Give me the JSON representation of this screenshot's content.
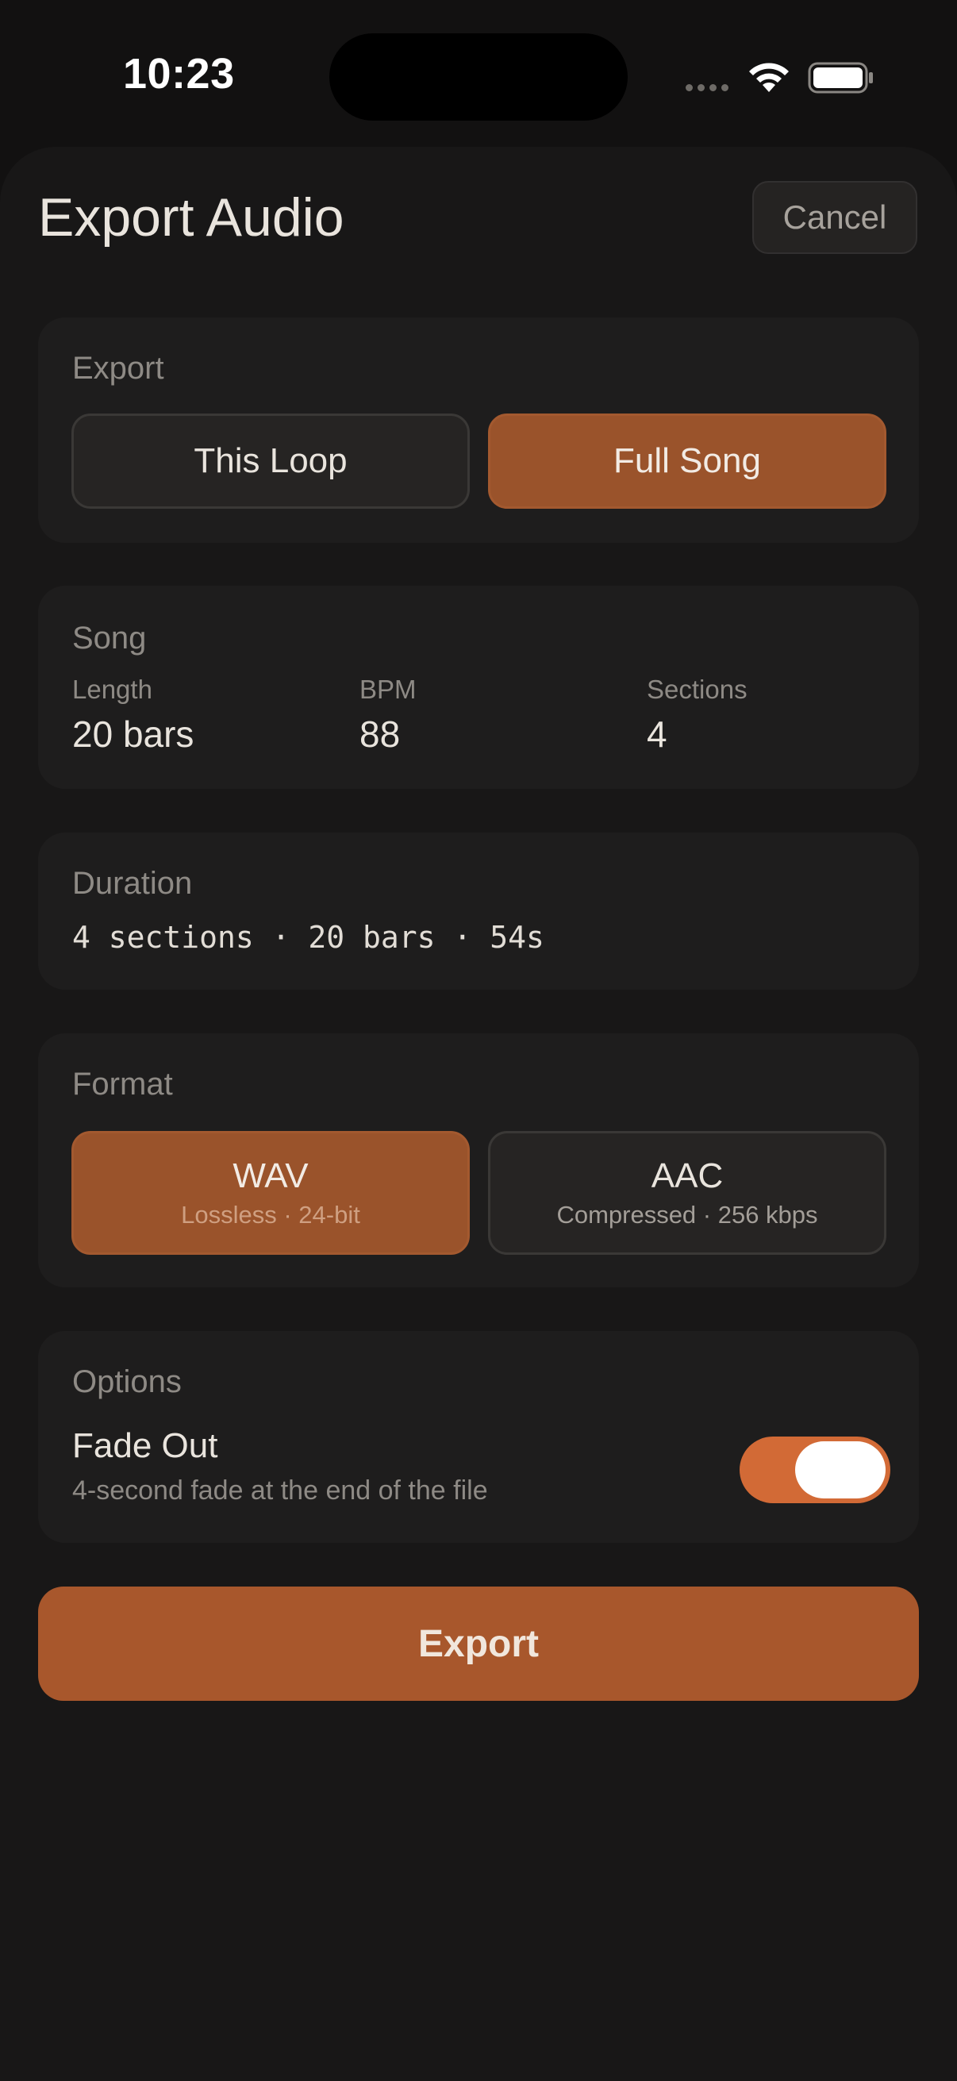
{
  "status_bar": {
    "time": "10:23"
  },
  "header": {
    "title": "Export Audio",
    "cancel_label": "Cancel"
  },
  "export_scope": {
    "heading": "Export",
    "options": [
      {
        "label": "This Loop",
        "selected": false
      },
      {
        "label": "Full Song",
        "selected": true
      }
    ]
  },
  "song": {
    "heading": "Song",
    "stats": [
      {
        "label": "Length",
        "value": "20 bars"
      },
      {
        "label": "BPM",
        "value": "88"
      },
      {
        "label": "Sections",
        "value": "4"
      }
    ]
  },
  "duration": {
    "heading": "Duration",
    "summary": "4 sections · 20 bars · 54s"
  },
  "format": {
    "heading": "Format",
    "options": [
      {
        "label": "WAV",
        "description": "Lossless · 24-bit",
        "selected": true
      },
      {
        "label": "AAC",
        "description": "Compressed · 256 kbps",
        "selected": false
      }
    ]
  },
  "options": {
    "heading": "Options",
    "fade_out": {
      "label": "Fade Out",
      "description": "4-second fade at the end of the file",
      "enabled": true
    }
  },
  "export_button_label": "Export",
  "colors": {
    "accent": "#a8572c",
    "toggle_on": "#d26a36",
    "background": "#121111",
    "card": "#1e1d1d"
  },
  "icons": [
    "wifi-icon",
    "battery-icon",
    "cellular-signal-icon"
  ]
}
